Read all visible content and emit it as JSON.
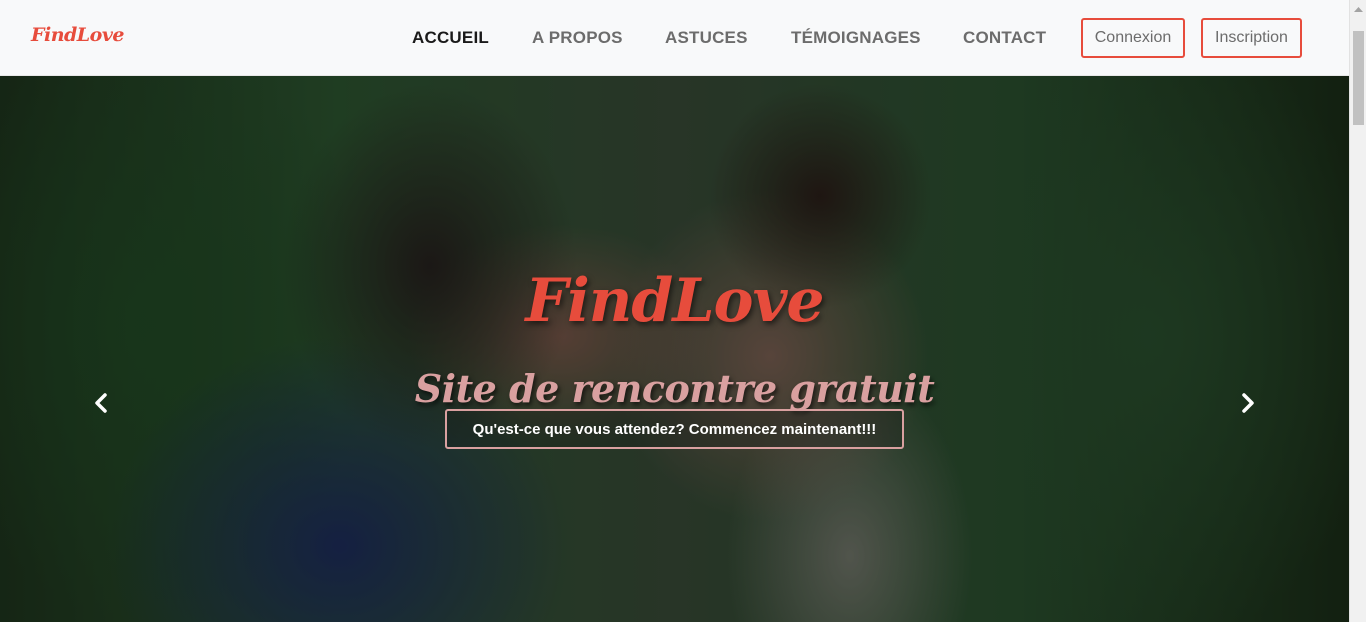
{
  "navbar": {
    "brand": "FindLove",
    "links": [
      {
        "label": "ACCUEIL",
        "active": true
      },
      {
        "label": "A PROPOS",
        "active": false
      },
      {
        "label": "ASTUCES",
        "active": false
      },
      {
        "label": "TÉMOIGNAGES",
        "active": false
      },
      {
        "label": "CONTACT",
        "active": false
      }
    ],
    "login_label": "Connexion",
    "signup_label": "Inscription"
  },
  "hero": {
    "title": "FindLove",
    "subtitle": "Site de rencontre gratuit",
    "cta_label": "Qu'est-ce que vous attendez? Commencez maintenant!!!",
    "prev_icon": "chevron-left-icon",
    "next_icon": "chevron-right-icon"
  },
  "colors": {
    "brand": "#e74c3c",
    "subtitle": "#d9a0a0",
    "nav_text": "#6c6c6c",
    "nav_active": "#1a1a1a"
  }
}
